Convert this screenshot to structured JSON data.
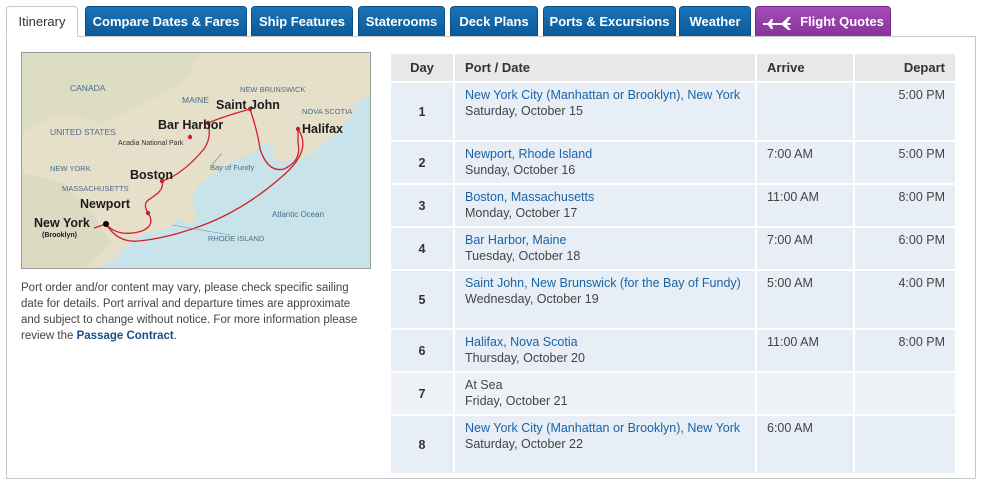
{
  "tabs": [
    {
      "label": "Itinerary",
      "active": true
    },
    {
      "label": "Compare Dates & Fares"
    },
    {
      "label": "Ship Features"
    },
    {
      "label": "Staterooms"
    },
    {
      "label": "Deck Plans"
    },
    {
      "label": "Ports & Excursions"
    },
    {
      "label": "Weather"
    },
    {
      "label": "Flight Quotes",
      "icon": "airplane-icon"
    }
  ],
  "map": {
    "labels": {
      "canada": "CANADA",
      "maine": "MAINE",
      "new_brunswick": "NEW BRUNSWICK",
      "nova_scotia": "NOVA SCOTIA",
      "united_states": "UNITED STATES",
      "new_york_state": "NEW YORK",
      "massachusetts": "MASSACHUSETTS",
      "rhode_island": "RHODE ISLAND",
      "atlantic": "Atlantic Ocean",
      "acadia": "Acadia National Park",
      "bay_of_fundy": "Bay of Fundy",
      "saint_john": "Saint John",
      "bar_harbor": "Bar Harbor",
      "halifax": "Halifax",
      "boston": "Boston",
      "newport": "Newport",
      "new_york": "New York",
      "brooklyn": "(Brooklyn)"
    }
  },
  "note": {
    "text": "Port order and/or content may vary, please check specific sailing date for details. Port arrival and departure times are approximate and subject to change without notice. For more information please review the ",
    "link": "Passage Contract",
    "end": "."
  },
  "table": {
    "headers": {
      "day": "Day",
      "port": "Port / Date",
      "arrive": "Arrive",
      "depart": "Depart"
    },
    "rows": [
      {
        "day": "1",
        "port": "New York City (Manhattan or Brooklyn), New York",
        "date": "Saturday, October 15",
        "arrive": "",
        "depart": "5:00 PM"
      },
      {
        "day": "2",
        "port": "Newport, Rhode Island",
        "date": "Sunday, October 16",
        "arrive": "7:00 AM",
        "depart": "5:00 PM"
      },
      {
        "day": "3",
        "port": "Boston, Massachusetts",
        "date": "Monday, October 17",
        "arrive": "11:00 AM",
        "depart": "8:00 PM"
      },
      {
        "day": "4",
        "port": "Bar Harbor, Maine",
        "date": "Tuesday, October 18",
        "arrive": "7:00 AM",
        "depart": "6:00 PM"
      },
      {
        "day": "5",
        "port": "Saint John, New Brunswick (for the Bay of Fundy)",
        "date": "Wednesday, October 19",
        "arrive": "5:00 AM",
        "depart": "4:00 PM"
      },
      {
        "day": "6",
        "port": "Halifax, Nova Scotia",
        "date": "Thursday, October 20",
        "arrive": "11:00 AM",
        "depart": "8:00 PM"
      },
      {
        "day": "7",
        "port": "At Sea",
        "date": "Friday, October 21",
        "arrive": "",
        "depart": "",
        "link": false
      },
      {
        "day": "8",
        "port": "New York City (Manhattan or Brooklyn), New York",
        "date": "Saturday, October 22",
        "arrive": "6:00 AM",
        "depart": ""
      }
    ]
  },
  "colors": {
    "tab_blue": "#0c5a98",
    "tab_purple": "#863498",
    "link_blue": "#1a63a6",
    "route_red": "#d0202a",
    "sea": "#c9e3ea",
    "land": "#e9e2cf"
  }
}
